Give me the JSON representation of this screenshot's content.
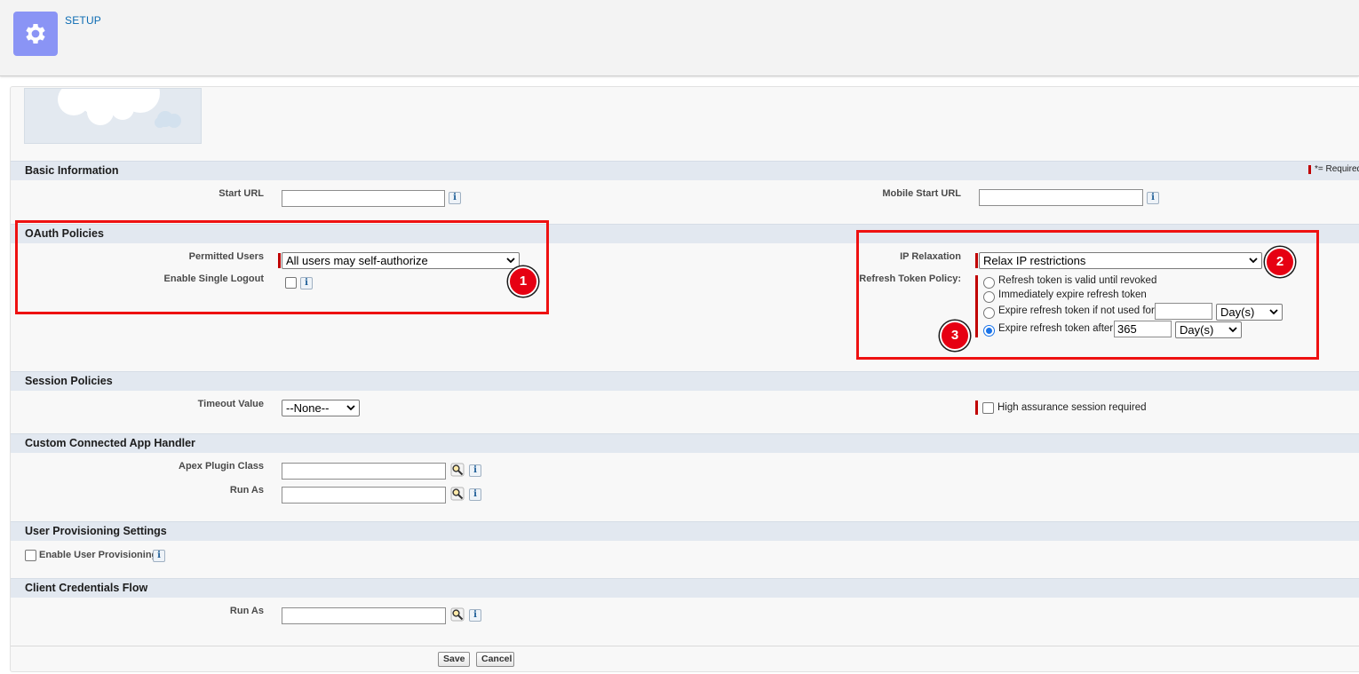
{
  "header": {
    "title": "SETUP",
    "icon": "gear-icon"
  },
  "required_legend": "= Required",
  "basic_information": {
    "title": "Basic Information",
    "start_url_label": "Start URL",
    "start_url_value": "",
    "mobile_start_url_label": "Mobile Start URL",
    "mobile_start_url_value": ""
  },
  "oauth_policies": {
    "title": "OAuth Policies",
    "permitted_users_label": "Permitted Users",
    "permitted_users_value": "All users may self-authorize",
    "enable_single_logout_label": "Enable Single Logout",
    "enable_single_logout_checked": false,
    "ip_relaxation_label": "IP Relaxation",
    "ip_relaxation_value": "Relax IP restrictions",
    "refresh_token_policy_label": "Refresh Token Policy:",
    "refresh_options": [
      {
        "label": "Refresh token is valid until revoked",
        "selected": false
      },
      {
        "label": "Immediately expire refresh token",
        "selected": false
      },
      {
        "label": "Expire refresh token if not used for",
        "selected": false,
        "value": "",
        "unit": "Day(s)"
      },
      {
        "label": "Expire refresh token after",
        "selected": true,
        "value": "365",
        "unit": "Day(s)"
      }
    ]
  },
  "session_policies": {
    "title": "Session Policies",
    "timeout_label": "Timeout Value",
    "timeout_value": "--None--",
    "high_assurance_label": "High assurance session required",
    "high_assurance_checked": false
  },
  "custom_handler": {
    "title": "Custom Connected App Handler",
    "apex_plugin_label": "Apex Plugin Class",
    "apex_plugin_value": "",
    "run_as_label": "Run As",
    "run_as_value": ""
  },
  "user_provisioning": {
    "title": "User Provisioning Settings",
    "enable_label": "Enable User Provisioning",
    "enabled": false
  },
  "client_credentials": {
    "title": "Client Credentials Flow",
    "run_as_label": "Run As",
    "run_as_value": ""
  },
  "markers": [
    "1",
    "2",
    "3"
  ],
  "info_glyph": "i",
  "buttons": {
    "save": "Save",
    "cancel": "Cancel"
  },
  "colors": {
    "highlight": "#ee1111",
    "marker": "#e60012",
    "required": "#c00000",
    "header_icon_bg": "#8a94f5",
    "link": "#0b6bb3"
  }
}
